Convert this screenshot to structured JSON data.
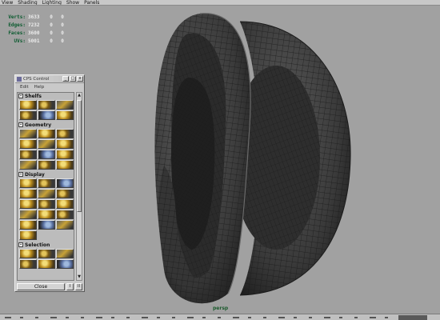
{
  "menubar": {
    "items": [
      "View",
      "Shading",
      "Lighting",
      "Show",
      "Panels"
    ]
  },
  "hud": {
    "rows": [
      {
        "label": "Verts:",
        "v1": "3633",
        "v2": "0",
        "v3": "0"
      },
      {
        "label": "Edges:",
        "v1": "7232",
        "v2": "0",
        "v3": "0"
      },
      {
        "label": "Faces:",
        "v1": "3600",
        "v2": "0",
        "v3": "0"
      },
      {
        "label": "UVs:",
        "v1": "5001",
        "v2": "0",
        "v3": "0"
      }
    ]
  },
  "panel": {
    "title": "CPS Control",
    "window_buttons": [
      "_",
      "□",
      "x"
    ],
    "menu": [
      "Edit",
      "Help"
    ],
    "sections": [
      {
        "label": "Shelfs",
        "icons": [
          "shelf-tool-icon",
          "shelf-tool-icon",
          "shelf-tool-icon",
          "shelf-tool-icon",
          "shelf-tool-icon",
          "shelf-tool-icon"
        ]
      },
      {
        "label": "Geometry",
        "icons": [
          "geometry-tool-icon",
          "geometry-tool-icon",
          "geometry-tool-icon",
          "geometry-tool-icon",
          "geometry-tool-icon",
          "geometry-tool-icon",
          "geometry-tool-icon",
          "geometry-tool-icon",
          "geometry-tool-icon",
          "geometry-tool-icon",
          "geometry-tool-icon",
          "geometry-tool-icon"
        ]
      },
      {
        "label": "Display",
        "icons": [
          "display-tool-icon",
          "display-tool-icon",
          "display-tool-icon",
          "display-tool-icon",
          "display-tool-icon",
          "display-tool-icon",
          "display-tool-icon",
          "display-tool-icon",
          "display-tool-icon",
          "display-tool-icon",
          "display-tool-icon",
          "display-tool-icon",
          "display-tool-icon",
          "display-tool-icon",
          "display-tool-icon",
          "display-tool-icon"
        ]
      },
      {
        "label": "Selection",
        "icons": [
          "selection-tool-icon",
          "selection-tool-icon",
          "selection-tool-icon",
          "selection-tool-icon",
          "selection-tool-icon",
          "selection-tool-icon"
        ]
      }
    ],
    "close_label": "Close",
    "mini_buttons": [
      "I",
      "II"
    ]
  },
  "viewport": {
    "camera_label": "persp",
    "mesh_color": "#3c3c3c",
    "wire_color": "#1a1a1a",
    "background": "#a1a1a1"
  },
  "colors": {
    "hud_label": "#0a5a2e",
    "hud_value": "#ececec",
    "camera_label": "#1b5a2c"
  }
}
